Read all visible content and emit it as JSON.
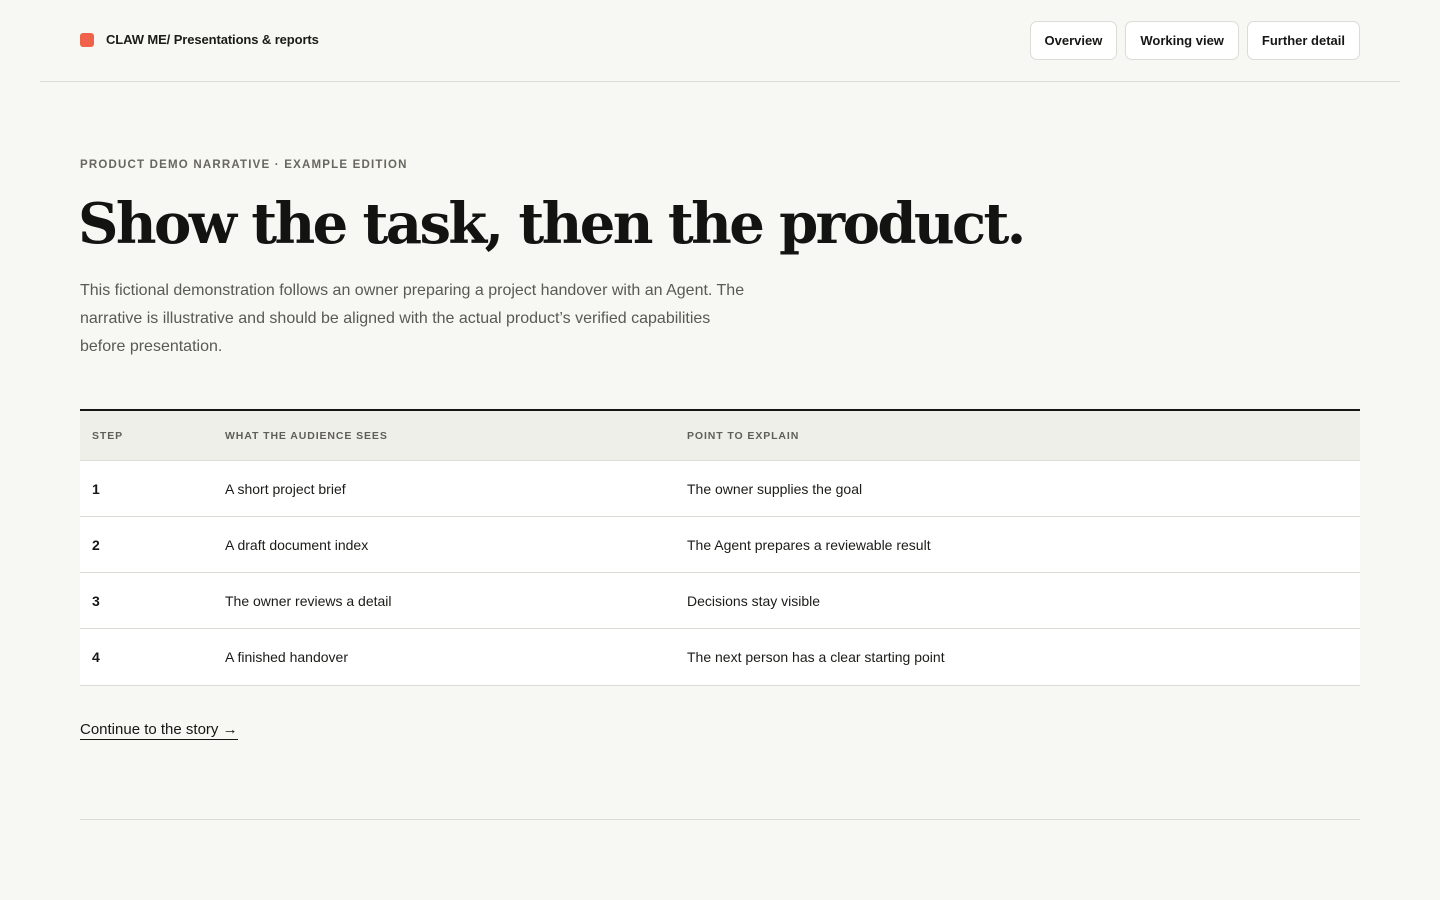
{
  "header": {
    "brand": "CLAW ME/ Presentations & reports",
    "nav": [
      "Overview",
      "Working view",
      "Further detail"
    ]
  },
  "hero": {
    "eyebrow": "PRODUCT DEMO NARRATIVE · EXAMPLE EDITION",
    "title": "Show the task, then the product.",
    "lede": "This fictional demonstration follows an owner preparing a project handover with an Agent. The narrative is illustrative and should be aligned with the actual product’s verified capabilities before presentation."
  },
  "table": {
    "headers": [
      "STEP",
      "WHAT THE AUDIENCE SEES",
      "POINT TO EXPLAIN"
    ],
    "rows": [
      {
        "step": "1",
        "sees": "A short project brief",
        "point": "The owner supplies the goal"
      },
      {
        "step": "2",
        "sees": "A draft document index",
        "point": "The Agent prepares a reviewable result"
      },
      {
        "step": "3",
        "sees": "The owner reviews a detail",
        "point": "Decisions stay visible"
      },
      {
        "step": "4",
        "sees": "A finished handover",
        "point": "The next person has a clear starting point"
      }
    ]
  },
  "cta": {
    "label": "Continue to the story →"
  },
  "colors": {
    "accent": "#f0634a",
    "background": "#f7f7f3",
    "ink": "#161614"
  }
}
